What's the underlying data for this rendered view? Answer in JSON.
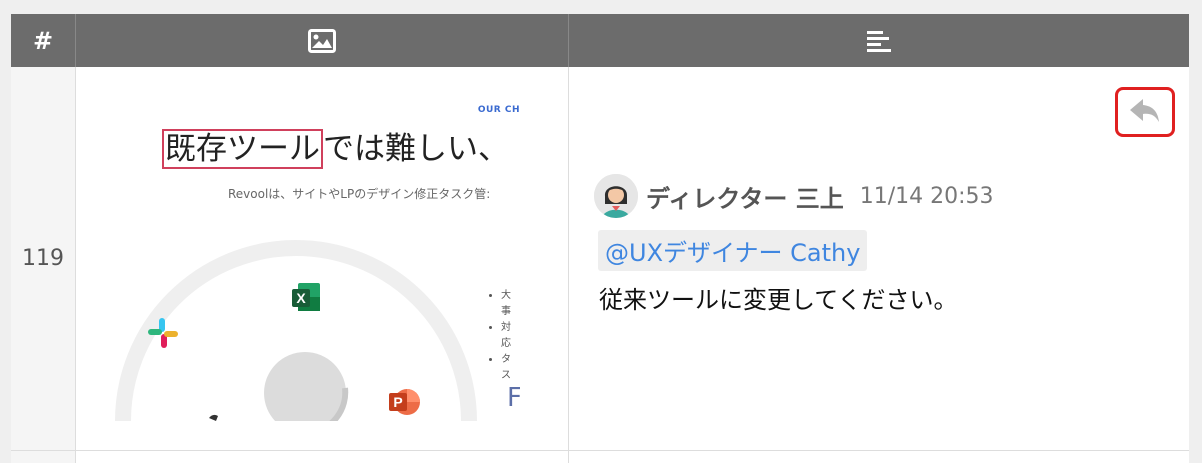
{
  "header": {
    "col_number_label": "#",
    "col_image_icon": "image-icon",
    "col_text_icon": "align-left-icon"
  },
  "row": {
    "number": "119",
    "thumbnail": {
      "tag": "OUR CH",
      "title_highlight": "既存ツール",
      "title_rest": "では難しい、",
      "subtitle": "Revoolは、サイトやLPのデザイン修正タスク管:",
      "bullets": [
        "大事",
        "対応",
        "タス"
      ],
      "trailing_letter": "F",
      "icons": [
        "slack-icon",
        "excel-icon",
        "powerpoint-icon"
      ]
    },
    "comment": {
      "author": "ディレクター 三上",
      "timestamp": "11/14 20:53",
      "mention": "@UXデザイナー Cathy",
      "text": "従来ツールに変更してください。",
      "reply_icon": "reply-icon"
    }
  },
  "colors": {
    "header_bg": "#6c6c6c",
    "highlight_border": "#d0405c",
    "mention_text": "#3f86e0",
    "reply_outline": "#e02020"
  }
}
